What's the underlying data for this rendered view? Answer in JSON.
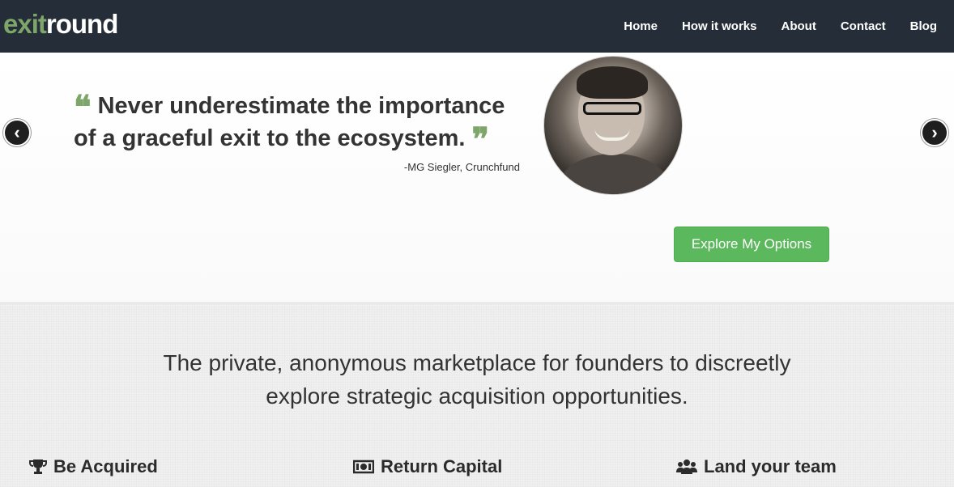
{
  "brand": {
    "part1": "exit",
    "part2": "round"
  },
  "nav": {
    "items": [
      "Home",
      "How it works",
      "About",
      "Contact",
      "Blog"
    ]
  },
  "hero": {
    "quote": "Never underestimate the importance of a graceful exit to the ecosystem.",
    "attribution": "-MG Siegler, Crunchfund",
    "prev_label": "‹",
    "next_label": "›",
    "cta_label": "Explore My Options"
  },
  "lower": {
    "tagline_line1": "The private, anonymous marketplace for founders to discreetly",
    "tagline_line2": "explore strategic acquisition opportunities.",
    "features": [
      {
        "icon": "trophy-icon",
        "label": "Be Acquired"
      },
      {
        "icon": "money-icon",
        "label": "Return Capital"
      },
      {
        "icon": "group-icon",
        "label": "Land your team"
      }
    ]
  },
  "colors": {
    "navbar": "#252d38",
    "accent_green": "#7fa66a",
    "cta_green": "#5cb85c"
  }
}
